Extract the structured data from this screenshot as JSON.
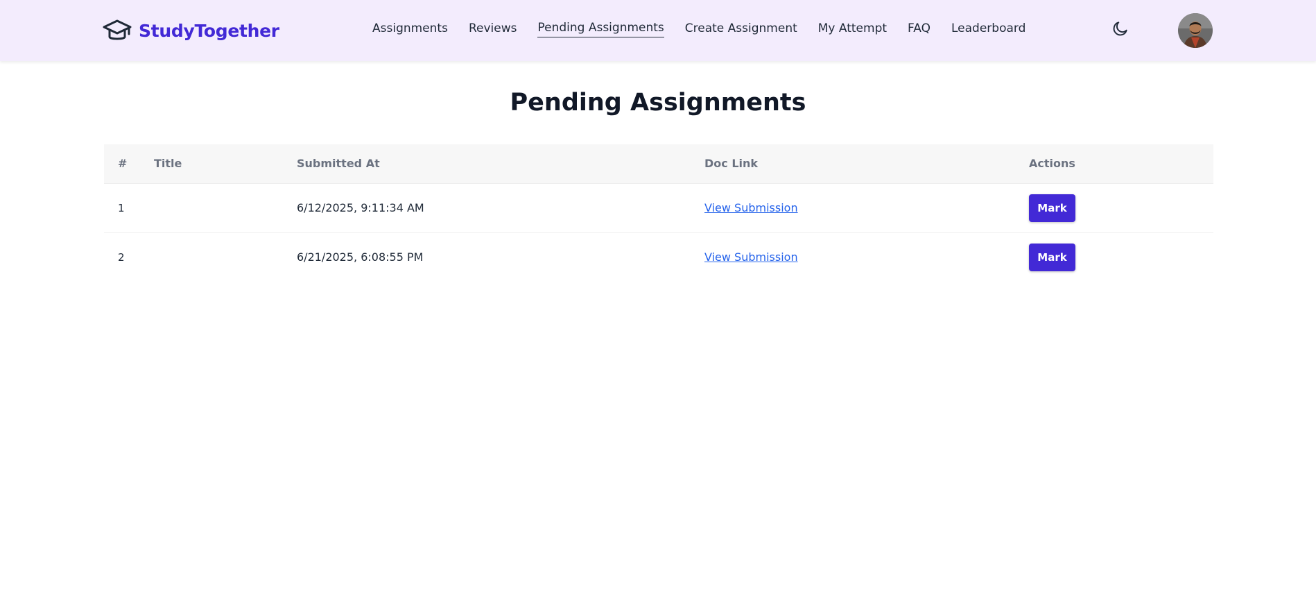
{
  "app": {
    "brand_name": "StudyTogether",
    "brand_color": "#4229d6"
  },
  "nav": {
    "items": [
      {
        "label": "Assignments",
        "active": false
      },
      {
        "label": "Reviews",
        "active": false
      },
      {
        "label": "Pending Assignments",
        "active": true
      },
      {
        "label": "Create Assignment",
        "active": false
      },
      {
        "label": "My Attempt",
        "active": false
      },
      {
        "label": "FAQ",
        "active": false
      },
      {
        "label": "Leaderboard",
        "active": false
      }
    ],
    "theme_icon": "moon-icon",
    "avatar_icon": "user-avatar"
  },
  "main": {
    "title": "Pending Assignments",
    "table": {
      "columns": [
        "#",
        "Title",
        "Submitted At",
        "Doc Link",
        "Actions"
      ],
      "rows": [
        {
          "num": "1",
          "title": "",
          "submitted_at": "6/12/2025, 9:11:34 AM",
          "doc_link": "View Submission",
          "action": "Mark"
        },
        {
          "num": "2",
          "title": "",
          "submitted_at": "6/21/2025, 6:08:55 PM",
          "doc_link": "View Submission",
          "action": "Mark"
        }
      ]
    }
  }
}
